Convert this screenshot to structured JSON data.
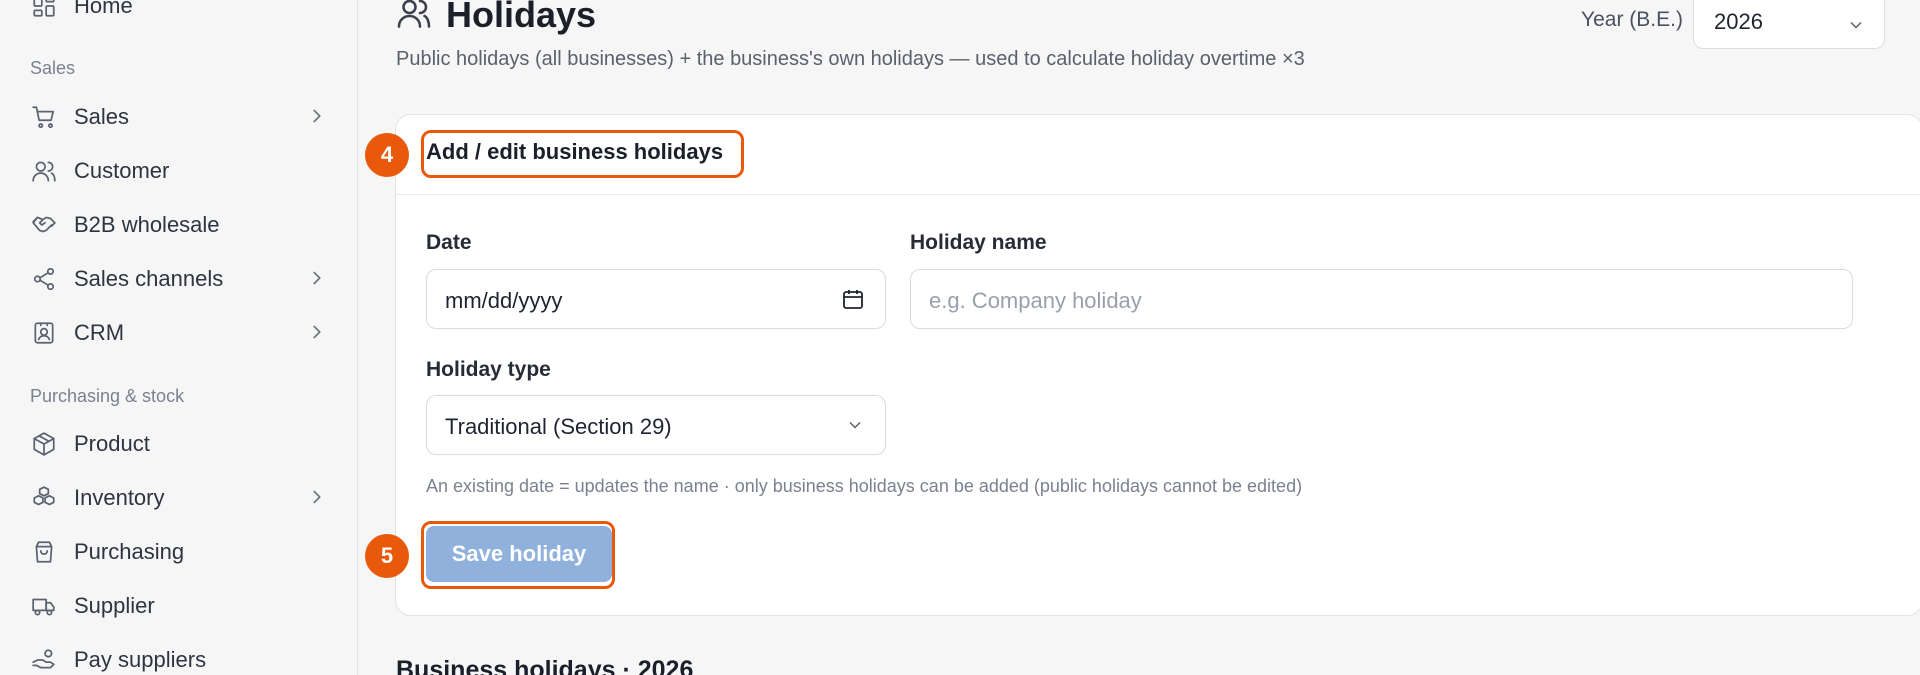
{
  "sidebar": {
    "home": "Home",
    "section_sales": "Sales",
    "items_sales": [
      {
        "label": "Sales",
        "icon": "cart-icon",
        "has_children": true
      },
      {
        "label": "Customer",
        "icon": "users-icon",
        "has_children": false
      },
      {
        "label": "B2B wholesale",
        "icon": "handshake-icon",
        "has_children": false
      },
      {
        "label": "Sales channels",
        "icon": "share-icon",
        "has_children": true
      },
      {
        "label": "CRM",
        "icon": "contact-card-icon",
        "has_children": true
      }
    ],
    "section_purchasing": "Purchasing & stock",
    "items_purchasing": [
      {
        "label": "Product",
        "icon": "box-icon",
        "has_children": false
      },
      {
        "label": "Inventory",
        "icon": "boxes-icon",
        "has_children": true
      },
      {
        "label": "Purchasing",
        "icon": "bag-icon",
        "has_children": false
      },
      {
        "label": "Supplier",
        "icon": "truck-icon",
        "has_children": false
      },
      {
        "label": "Pay suppliers",
        "icon": "hand-coins-icon",
        "has_children": false
      }
    ]
  },
  "page": {
    "title": "Holidays",
    "subtitle": "Public holidays (all businesses) + the business's own holidays — used to calculate holiday overtime ×3",
    "year_label": "Year (B.E.)",
    "year_value": "2026"
  },
  "form": {
    "card_title": "Add / edit business holidays",
    "date_label": "Date",
    "date_value": "mm/dd/yyyy",
    "name_label": "Holiday name",
    "name_placeholder": "e.g. Company holiday",
    "type_label": "Holiday type",
    "type_value": "Traditional (Section 29)",
    "hint": "An existing date = updates the name · only business holidays can be added (public holidays cannot be edited)",
    "save_label": "Save holiday"
  },
  "annotations": {
    "step_title": "4",
    "step_save": "5",
    "color": "#e8590c"
  },
  "list": {
    "heading": "Business holidays · 2026"
  },
  "colors": {
    "accent": "#e8590c",
    "button_disabled": "#8fb1dc"
  }
}
